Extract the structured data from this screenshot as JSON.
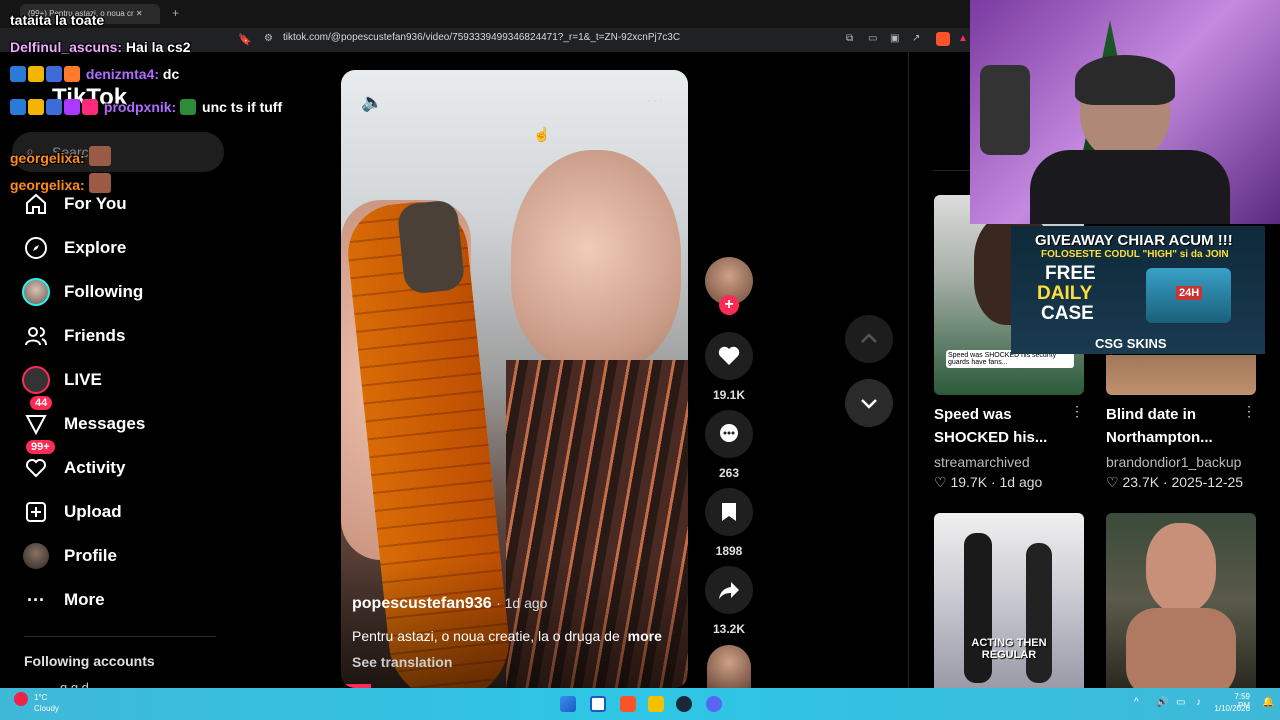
{
  "browser": {
    "tab_title": "(99+) Pentru astazi, o noua cr",
    "url": "tiktok.com/@popescustefan936/video/7593339499346824471?_r=1&_t=ZN-92xcnPj7c3C"
  },
  "sidebar": {
    "logo": "TikTok",
    "search_placeholder": "Search",
    "items": [
      {
        "label": "For You",
        "icon": "home-icon"
      },
      {
        "label": "Explore",
        "icon": "compass-icon"
      },
      {
        "label": "Following",
        "icon": "following-avatar-icon"
      },
      {
        "label": "Friends",
        "icon": "friends-icon"
      },
      {
        "label": "LIVE",
        "icon": "live-icon"
      },
      {
        "label": "Messages",
        "icon": "messages-icon",
        "badge": "44"
      },
      {
        "label": "Activity",
        "icon": "activity-icon",
        "badge": "99+"
      },
      {
        "label": "Upload",
        "icon": "upload-icon"
      },
      {
        "label": "Profile",
        "icon": "profile-avatar-icon"
      },
      {
        "label": "More",
        "icon": "more-icon"
      }
    ],
    "following_accounts_label": "Following accounts",
    "following_first": "g g d"
  },
  "chat": {
    "top_line": "tataita la toate",
    "messages": [
      {
        "user": "Delfinul_ascuns:",
        "text": "Hai la cs2",
        "color": "#f0a8ff"
      },
      {
        "user": "denizmta4:",
        "text": "dc",
        "color": "#b06cff"
      },
      {
        "user": "prodpxnik:",
        "text": "unc ts if tuff",
        "color": "#b06cff"
      },
      {
        "user": "georgelixa:",
        "text": "",
        "color": "#ff8c1a"
      },
      {
        "user": "georgelixa:",
        "text": "",
        "color": "#ff8c1a"
      }
    ]
  },
  "video": {
    "author": "popescustefan936",
    "time_ago": "· 1d ago",
    "caption": "Pentru astazi, o noua creatie, la o druga de",
    "more": "more",
    "translation": "See translation"
  },
  "actions": {
    "likes": "19.1K",
    "comments": "263",
    "saves": "1898",
    "shares": "13.2K"
  },
  "recommendations": [
    {
      "title1": "Speed was",
      "title2": "SHOCKED his...",
      "author": "streamarchived",
      "stat": "19.7K · 1d ago",
      "thumb_text": "Speed was SHOCKED his security guards have fans..."
    },
    {
      "title1": "Blind date in",
      "title2": "Northampton...",
      "author": "brandondior1_backup",
      "stat": "23.7K · 2025-12-25",
      "thumb_text": ""
    },
    {
      "title1": "",
      "title2": "",
      "author": "",
      "stat": "",
      "thumb_text": "ACTING THEN REGULAR"
    },
    {
      "title1": "",
      "title2": "",
      "author": "",
      "stat": "",
      "thumb_text": ""
    }
  ],
  "overlay": {
    "giveaway_line1": "GIVEAWAY CHIAR ACUM !!!",
    "giveaway_line2": "FOLOSESTE CODUL \"HIGH\" si da JOIN",
    "free": "FREE",
    "daily": "DAILY",
    "case": "CASE",
    "tag": "24H",
    "brand": "CSG SKINS"
  },
  "taskbar": {
    "weather_temp": "1°C",
    "weather_desc": "Cloudy",
    "time": "7:59 PM",
    "date": "1/10/2026"
  }
}
